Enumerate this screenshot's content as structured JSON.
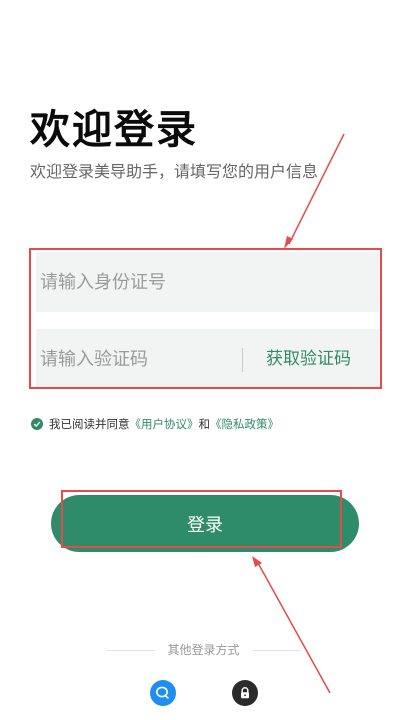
{
  "header": {
    "title": "欢迎登录",
    "subtitle": "欢迎登录美导助手，请填写您的用户信息"
  },
  "form": {
    "id_placeholder": "请输入身份证号",
    "code_placeholder": "请输入验证码",
    "get_code_label": "获取验证码"
  },
  "agreement": {
    "prefix": "我已阅读并同意",
    "user_agreement": "《用户协议》",
    "and": "和",
    "privacy_policy": "《隐私政策》"
  },
  "login_button": {
    "label": "登录"
  },
  "other_login": {
    "label": "其他登录方式",
    "icons": [
      "chat-icon",
      "lock-icon"
    ]
  },
  "colors": {
    "brand": "#2f8c6b",
    "annotation": "#e64a4a",
    "chat": "#1f8ef1"
  }
}
